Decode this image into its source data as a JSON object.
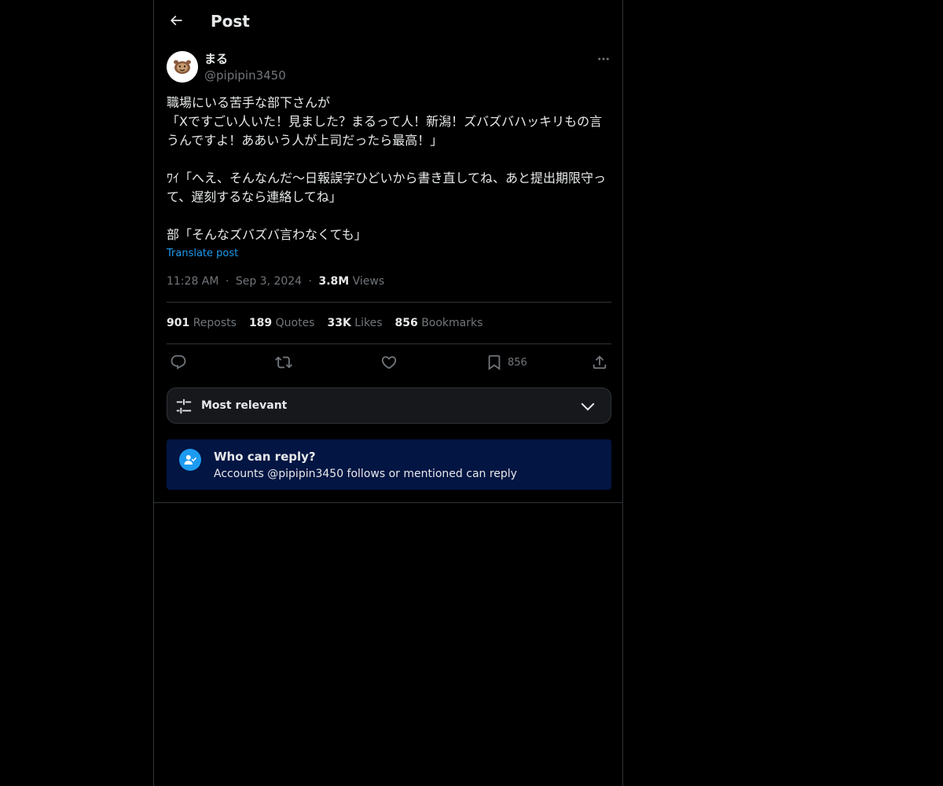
{
  "header": {
    "title": "Post"
  },
  "author": {
    "display_name": "まる",
    "handle": "@pipipin3450"
  },
  "post": {
    "text": "職場にいる苦手な部下さんが\n「Xですごい人いた！見ました？まるって人！新潟！ズバズバハッキリもの言うんですよ！ああいう人が上司だったら最高！」\n\nﾜｲ「へえ、そんなんだ〜日報誤字ひどいから書き直してね、あと提出期限守って、遅刻するなら連絡してね」\n\n部「そんなズバズバ言わなくても」",
    "translate_label": "Translate post",
    "time": "11:28 AM",
    "date": "Sep 3, 2024",
    "views_count": "3.8M",
    "views_label": "Views",
    "separator": "·"
  },
  "stats": {
    "reposts_count": "901",
    "reposts_label": "Reposts",
    "quotes_count": "189",
    "quotes_label": "Quotes",
    "likes_count": "33K",
    "likes_label": "Likes",
    "bookmarks_count": "856",
    "bookmarks_label": "Bookmarks"
  },
  "actions": {
    "bookmark_count": "856"
  },
  "sort": {
    "label": "Most relevant"
  },
  "reply_restriction": {
    "title": "Who can reply?",
    "subtitle": "Accounts @pipipin3450 follows or mentioned can reply"
  },
  "colors": {
    "background": "#000000",
    "text_primary": "#e7e9ea",
    "text_secondary": "#71767b",
    "accent": "#1d9bf0",
    "border": "#2f3336",
    "reply_box_bg": "#031543"
  },
  "icons": {
    "back": "back-arrow-icon",
    "more": "more-options-icon",
    "reply": "reply-icon",
    "repost": "repost-icon",
    "like": "like-icon",
    "bookmark": "bookmark-icon",
    "share": "share-icon",
    "sort": "sliders-icon",
    "dropdown": "chevron-down-icon",
    "reply_restriction": "person-check-icon"
  }
}
